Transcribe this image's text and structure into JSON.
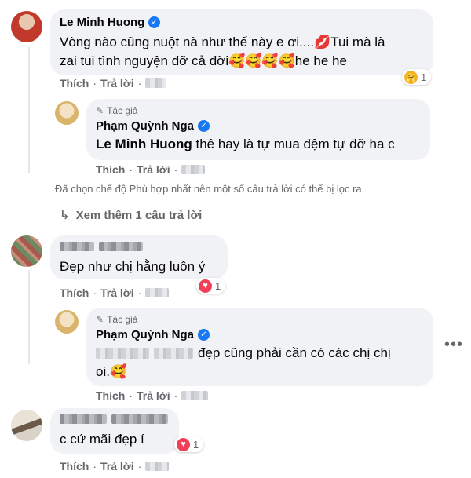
{
  "comment1": {
    "author": "Le Minh Huong",
    "text_line1": "Vòng nào cũng nuột nà như thế này e ơi....💋Tui mà là",
    "text_line2": "zai tui tình nguyện đỡ cả đời🥰🥰🥰🥰he he he",
    "like": "Thích",
    "reply": "Trả lời",
    "reaction_count": "1"
  },
  "reply1": {
    "badge": "Tác giả",
    "author": "Phạm Quỳnh Nga",
    "mention": "Le Minh Huong",
    "text": " thê hay là tự mua đệm tự đỡ ha c",
    "like": "Thích",
    "reply": "Trả lời"
  },
  "filter_note": "Đã chọn chế độ Phù hợp nhất nên một số câu trả lời có thể bị lọc ra.",
  "see_more": "Xem thêm 1 câu trả lời",
  "comment2": {
    "text": "Đẹp như chị hằng luôn ý",
    "like": "Thích",
    "reply": "Trả lời",
    "reaction_count": "1"
  },
  "reply2": {
    "badge": "Tác giả",
    "author": "Phạm Quỳnh Nga",
    "text_line1": "đẹp cũng phải cần có các chị chị",
    "text_line2": "oi.🥰",
    "like": "Thích",
    "reply": "Trả lời"
  },
  "comment3": {
    "text": "c cứ mãi đẹp í",
    "like": "Thích",
    "reply": "Trả lời",
    "reaction_count": "1"
  },
  "colors": {
    "bubble": "#f0f2f5",
    "verified": "#1877f2",
    "secondary_text": "#65676b",
    "love": "#f33e58",
    "care": "#f7b125"
  }
}
